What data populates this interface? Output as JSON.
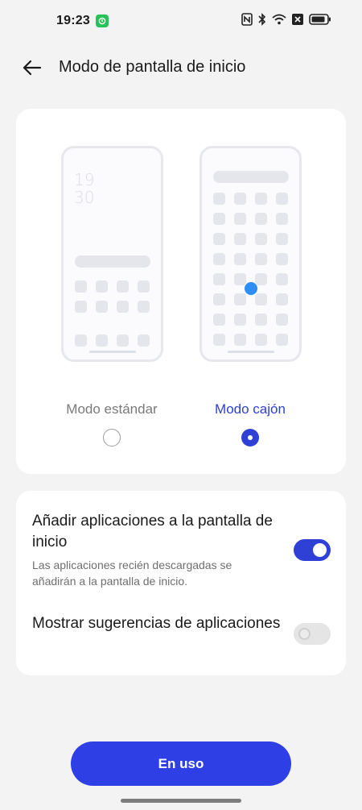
{
  "status_bar": {
    "time": "19:23",
    "notification_icon": "app-notification-icon",
    "icons": [
      "nfc-icon",
      "bluetooth-icon",
      "wifi-icon",
      "no-sim-icon",
      "battery-icon"
    ],
    "notification_color": "#27c15a"
  },
  "header": {
    "title": "Modo de pantalla de inicio",
    "back_icon": "back-arrow-icon"
  },
  "preview": {
    "standard": {
      "clock": "19\n30",
      "label": "Modo estándar",
      "selected": false
    },
    "drawer": {
      "label": "Modo cajón",
      "selected": true
    }
  },
  "settings": [
    {
      "title": "Añadir aplicaciones a la pantalla de inicio",
      "description": "Las aplicaciones recién descargadas se añadirán a la pantalla de inicio.",
      "enabled": true
    },
    {
      "title": "Mostrar sugerencias de aplicaciones",
      "description": "",
      "enabled": false
    }
  ],
  "button": {
    "label": "En uso"
  },
  "colors": {
    "accent": "#2e40d6",
    "button": "#2e40e5",
    "touch_dot": "#2f8df5",
    "background": "#f3f3f3"
  }
}
